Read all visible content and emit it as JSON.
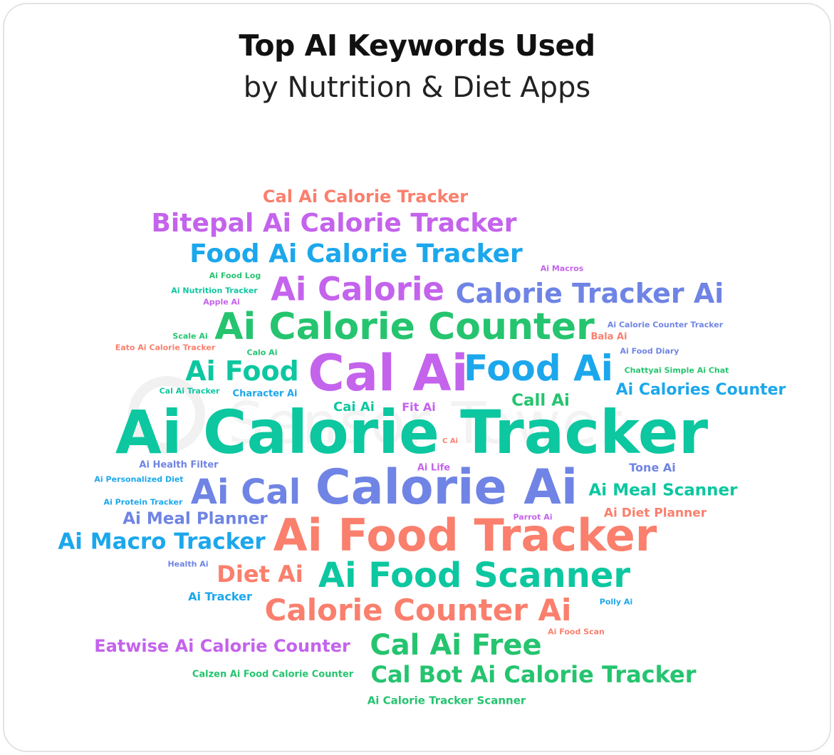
{
  "title": "Top AI Keywords Used",
  "subtitle": "by Nutrition & Diet Apps",
  "colors": {
    "orange": "#fa7f6d",
    "purple": "#c463ec",
    "blue": "#1ca7ec",
    "periwinkle": "#6f84e4",
    "green": "#25c46f",
    "teal": "#0cc7a0"
  },
  "keywords": [
    {
      "text": "Cal Ai Calorie Tracker",
      "color": "#fa7f6d"
    },
    {
      "text": "Bitepal Ai Calorie Tracker",
      "color": "#c463ec"
    },
    {
      "text": "Food Ai Calorie Tracker",
      "color": "#1ca7ec"
    },
    {
      "text": "Ai Macros",
      "color": "#c463ec"
    },
    {
      "text": "Ai Food Log",
      "color": "#25c46f"
    },
    {
      "text": "Ai Calorie",
      "color": "#c463ec"
    },
    {
      "text": "Calorie Tracker Ai",
      "color": "#6f84e4"
    },
    {
      "text": "Ai Nutrition Tracker",
      "color": "#0cc7a0"
    },
    {
      "text": "Apple Ai",
      "color": "#c463ec"
    },
    {
      "text": "Ai Calorie Counter",
      "color": "#25c46f"
    },
    {
      "text": "Ai Calorie Counter Tracker",
      "color": "#6f84e4"
    },
    {
      "text": "Scale Ai",
      "color": "#25c46f"
    },
    {
      "text": "Bala Ai",
      "color": "#fa7f6d"
    },
    {
      "text": "Eato Ai Calorie Tracker",
      "color": "#fa7f6d"
    },
    {
      "text": "Calo Ai",
      "color": "#25c46f"
    },
    {
      "text": "Ai Food Diary",
      "color": "#6f84e4"
    },
    {
      "text": "Ai Food",
      "color": "#0cc7a0"
    },
    {
      "text": "Cal Ai",
      "color": "#c463ec"
    },
    {
      "text": "Food Ai",
      "color": "#1ca7ec"
    },
    {
      "text": "Chattyai Simple Ai Chat",
      "color": "#25c46f"
    },
    {
      "text": "Cal Ai Tracker",
      "color": "#0cc7a0"
    },
    {
      "text": "Character Ai",
      "color": "#1ca7ec"
    },
    {
      "text": "Ai Calories Counter",
      "color": "#1ca7ec"
    },
    {
      "text": "Call Ai",
      "color": "#25c46f"
    },
    {
      "text": "Cai Ai",
      "color": "#0cc7a0"
    },
    {
      "text": "Fit Ai",
      "color": "#c463ec"
    },
    {
      "text": "Ai Calorie Tracker",
      "color": "#0cc7a0"
    },
    {
      "text": "C Ai",
      "color": "#fa7f6d"
    },
    {
      "text": "Ai Health Filter",
      "color": "#6f84e4"
    },
    {
      "text": "Ai Life",
      "color": "#c463ec"
    },
    {
      "text": "Tone Ai",
      "color": "#6f84e4"
    },
    {
      "text": "Ai Personalized Diet",
      "color": "#1ca7ec"
    },
    {
      "text": "Ai Cal",
      "color": "#6f84e4"
    },
    {
      "text": "Calorie Ai",
      "color": "#6f84e4"
    },
    {
      "text": "Ai Meal Scanner",
      "color": "#0cc7a0"
    },
    {
      "text": "Ai Protein Tracker",
      "color": "#1ca7ec"
    },
    {
      "text": "Ai Meal Planner",
      "color": "#6f84e4"
    },
    {
      "text": "Parrot Ai",
      "color": "#c463ec"
    },
    {
      "text": "Ai Diet Planner",
      "color": "#fa7f6d"
    },
    {
      "text": "Ai Macro Tracker",
      "color": "#1ca7ec"
    },
    {
      "text": "Ai Food Tracker",
      "color": "#fa7f6d"
    },
    {
      "text": "Health Ai",
      "color": "#6f84e4"
    },
    {
      "text": "Diet Ai",
      "color": "#fa7f6d"
    },
    {
      "text": "Ai Food Scanner",
      "color": "#0cc7a0"
    },
    {
      "text": "Ai Tracker",
      "color": "#1ca7ec"
    },
    {
      "text": "Calorie Counter Ai",
      "color": "#fa7f6d"
    },
    {
      "text": "Polly Ai",
      "color": "#1ca7ec"
    },
    {
      "text": "Ai Food Scan",
      "color": "#fa7f6d"
    },
    {
      "text": "Eatwise Ai Calorie Counter",
      "color": "#c463ec"
    },
    {
      "text": "Cal Ai Free",
      "color": "#25c46f"
    },
    {
      "text": "Calzen Ai Food Calorie Counter",
      "color": "#25c46f"
    },
    {
      "text": "Cal Bot Ai Calorie Tracker",
      "color": "#25c46f"
    },
    {
      "text": "Ai Calorie Tracker Scanner",
      "color": "#25c46f"
    }
  ]
}
